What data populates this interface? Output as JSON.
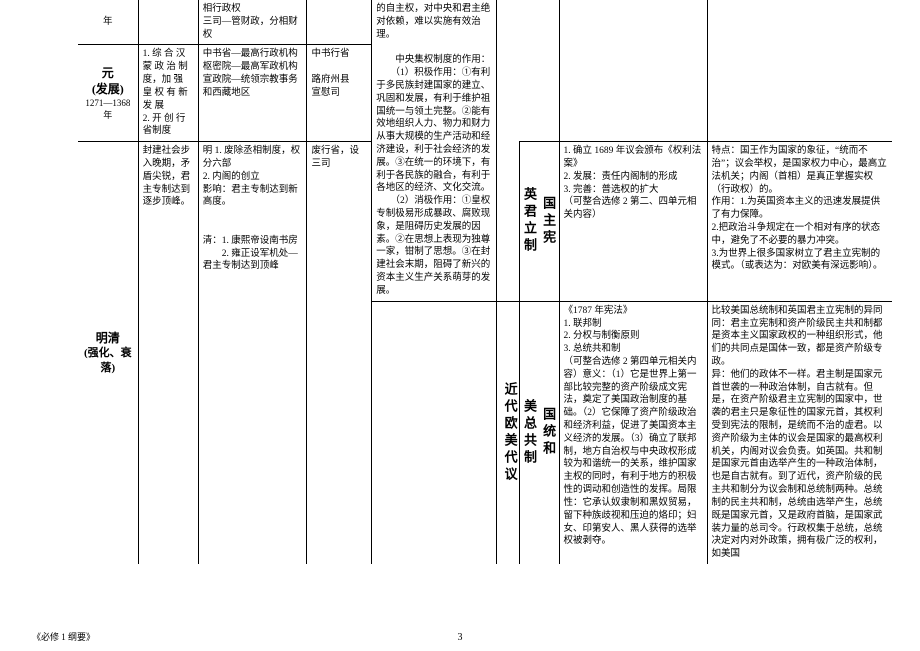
{
  "footer": {
    "series": "《必修 1 纲要》",
    "page": "3"
  },
  "colA_row1": "年",
  "colC_row1": "相行政权\n三司—管财政，分相财权",
  "colE_row1": "的自主权，对中央和君主绝对依赖，难以实施有效治理。\n\n　　中央集权制度的作用：\n　　（1）积极作用：①有利于多民族封建国家的建立、巩固和发展，有利于维护祖国统一与领土完整。②能有效地组织人力、物力和财力从事大规模的生产活动和经济建设，利于社会经济的发展。③在统一的环境下，有利于各民族的融合，有利于各地区的经济、文化交流。\n　　（2）消极作用：①皇权专制极易形成暴政、腐败现象，是阻碍历史发展的因素。②在思想上表现为独尊一家，钳制了思想。③在封建社会末期，阻碍了新兴的资本主义生产关系萌芽的发展。",
  "yuan_title": "元",
  "yuan_sub": "(发展)",
  "yuan_years": "1271—1368 年",
  "yuan_colB": "1. 综 合 汉 蒙 政 治 制度，加 强 皇 权 有 新 发 展\n2. 开 创 行 省制度",
  "yuan_colC": "中书省—最高行政机构\n枢密院—最高军政机构\n宣政院—统领宗教事务和西藏地区",
  "yuan_colD": "中书行省\n\n路府州县\n宣慰司",
  "mq_title": "明清",
  "mq_sub": "(强化、衰落)",
  "mq_colB": "封建社会步入晚期，矛盾尖锐，君主专制达到逐步顶峰。",
  "mq_colC": "明 1. 废除丞相制度，权分六部\n2. 内阁的创立\n影响：君主专制达到新高度。\n\n\n清：1. 康熙帝设南书房\n　　2. 雍正设军机处—君主专制达到顶峰",
  "mq_colD": "废行省，设三司",
  "center_col": "近代欧美代议",
  "uk_head1": "英君立制",
  "uk_head2": "国主宪",
  "uk_colH": "1. 确立 1689 年议会颁布《权利法案》\n2. 发展：责任内阁制的形成\n3. 完善：普选权的扩大\n（可整合选修 2 第二、四单元相关内容）",
  "uk_colI": "特点：国王作为国家的象征，“统而不治”；议会举权，是国家权力中心，最高立法机关；内阁（首相）是真正掌握实权（行政权）的。\n作用：1.为英国资本主义的迅速发展提供了有力保障。\n2.把政治斗争规定在一个相对有序的状态中，避免了不必要的暴力冲突。\n3.为世界上很多国家树立了君主立宪制的模式。（或表达为：对欧美有深远影响）。",
  "us_head1": "美总共制",
  "us_head2": "国统和",
  "us_colH": "《1787 年宪法》\n1. 联邦制\n2. 分权与制衡原则\n3. 总统共和制\n（可整合选修 2 第四单元相关内容）意义：（1）它是世界上第一部比较完整的资产阶级成文宪法，奠定了美国政治制度的基础。（2）它保障了资产阶级政治和经济利益，促进了美国资本主义经济的发展。（3）确立了联邦制，地方自治权与中央政权形成较为和谐统一的关系，维护国家主权的同时，有利于地方的积极性的调动和创造性的发挥。局限性：它承认奴隶制和黑奴贸易，留下种族歧视和压迫的烙印；妇女、印第安人、黑人获得的选举权被剥夺。",
  "us_colI": "比较美国总统制和英国君主立宪制的异同\n同：君主立宪制和资产阶级民主共和制都是资本主义国家政权的一种组织形式，他们的共同点是国体一致，都是资产阶级专政。\n异：他们的政体不一样。君主制是国家元首世袭的一种政治体制，自古就有。但是，在资产阶级君主立宪制的国家中，世袭的君主只是象征性的国家元首，其权利受到宪法的限制，是统而不治的虚君。以资产阶级为主体的议会是国家的最高权利机关，内阁对议会负责。如英国。共和制是国家元首由选举产生的一种政治体制，也是自古就有。到了近代，资产阶级的民主共和制分为议会制和总统制两种。总统制的民主共和制，总统由选举产生，总统既是国家元首，又是政府首脑，是国家武装力量的总司令。行政权集于总统，总统决定对内对外政策，拥有极广泛的权利，如美国"
}
